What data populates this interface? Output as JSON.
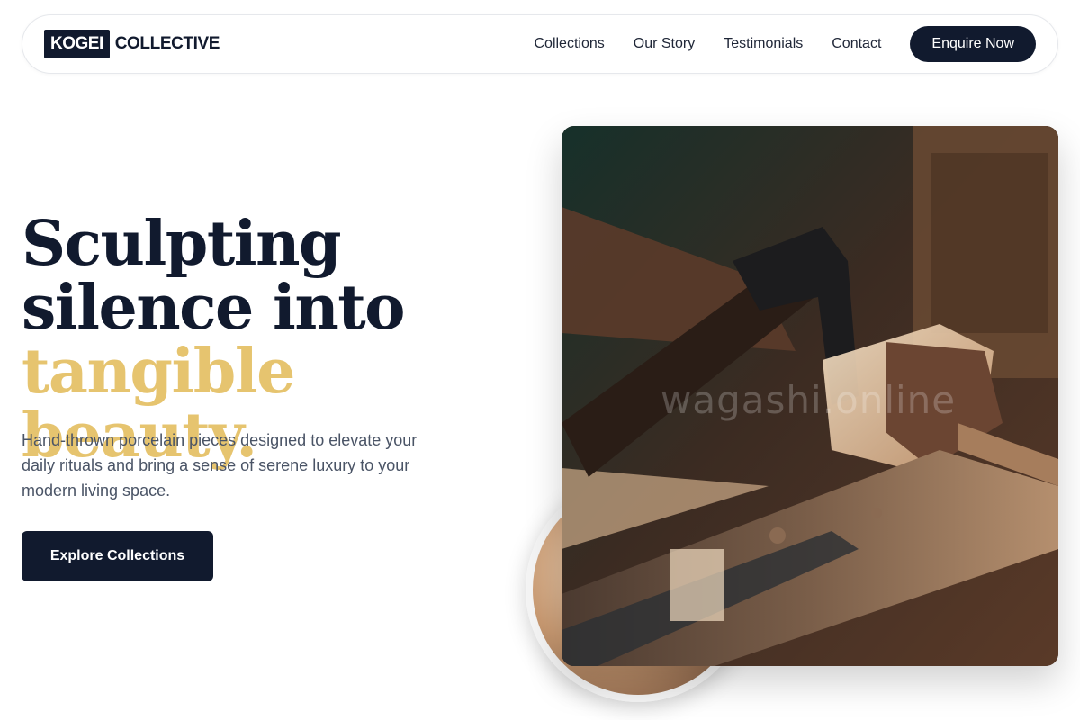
{
  "brand": {
    "logo_box": "KOGEI",
    "logo_word": "COLLECTIVE"
  },
  "nav": {
    "links": [
      "Collections",
      "Our Story",
      "Testimonials",
      "Contact"
    ],
    "cta": "Enquire Now"
  },
  "hero": {
    "title_line1": "Sculpting",
    "title_line2": "silence into",
    "title_accent": "tangible beauty.",
    "description": "Hand-thrown porcelain pieces designed to elevate your daily rituals and bring a sense of serene luxury to your modern living space.",
    "button": "Explore Collections"
  },
  "image": {
    "watermark": "wagashi.online"
  },
  "colors": {
    "navy": "#111a2e",
    "accent": "#e6c46f",
    "muted": "#4a5466"
  }
}
